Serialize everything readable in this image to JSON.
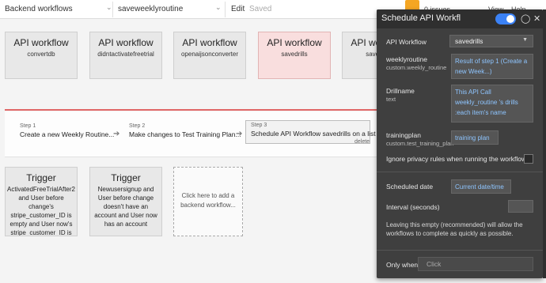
{
  "topbar": {
    "page_select": "Backend workflows",
    "workflow_select": "saveweeklyroutine",
    "edit_label": "Edit",
    "saved_label": "Saved",
    "issues_label": "0 issues",
    "view_label": "View",
    "help_label": "Help"
  },
  "workflows": [
    {
      "title": "API workflow",
      "name": "convertdb"
    },
    {
      "title": "API workflow",
      "name": "didntactivatefreetrial"
    },
    {
      "title": "API workflow",
      "name": "openaijsonconverter"
    },
    {
      "title": "API workflow",
      "name": "savedrills"
    },
    {
      "title": "API workflow",
      "name": "savejson"
    }
  ],
  "steps": [
    {
      "num": "Step 1",
      "name": "Create a new Weekly Routine..."
    },
    {
      "num": "Step 2",
      "name": "Make changes to Test Training Plan..."
    },
    {
      "num": "Step 3",
      "name": "Schedule API Workflow savedrills on a list"
    }
  ],
  "step_delete": "delete",
  "triggers": [
    {
      "title": "Trigger",
      "desc": "ActivatedFreeTrialAfter2 and User before change's stripe_customer_ID is empty and User now's stripe_customer_ID is not empty"
    },
    {
      "title": "Trigger",
      "desc": "Newusersignup and User before change doesn't have an account and User now has an account"
    }
  ],
  "add_card": "Click here to add a backend workflow...",
  "panel": {
    "title": "Schedule API Workflow s",
    "api_workflow_label": "API Workflow",
    "api_workflow_value": "savedrills",
    "weeklyroutine_label": "weeklyroutine",
    "weeklyroutine_type": "custom.weekly_routine",
    "weeklyroutine_value": "Result of step 1 (Create a new Week...)",
    "drillname_label": "Drillname",
    "drillname_type": "text",
    "drillname_value": "This API Call weekly_routine 's drills :each item's name",
    "trainingplan_label": "trainingplan",
    "trainingplan_type": "custom.test_training_plan",
    "trainingplan_value": "training plan",
    "ignore_privacy_label": "Ignore privacy rules when running the workflow",
    "scheduled_date_label": "Scheduled date",
    "scheduled_date_value": "Current date/time",
    "interval_label": "Interval (seconds)",
    "note": "Leaving this empty (recommended) will allow the workflows to complete as quickly as possible.",
    "only_when_label": "Only when",
    "only_when_placeholder": "Click"
  },
  "colors": {
    "accent_blue": "#3b82f6",
    "active_card": "#f9dede",
    "step_line": "#e06767",
    "issues_badge": "#f5a623",
    "expression_text": "#8ec5ff"
  }
}
